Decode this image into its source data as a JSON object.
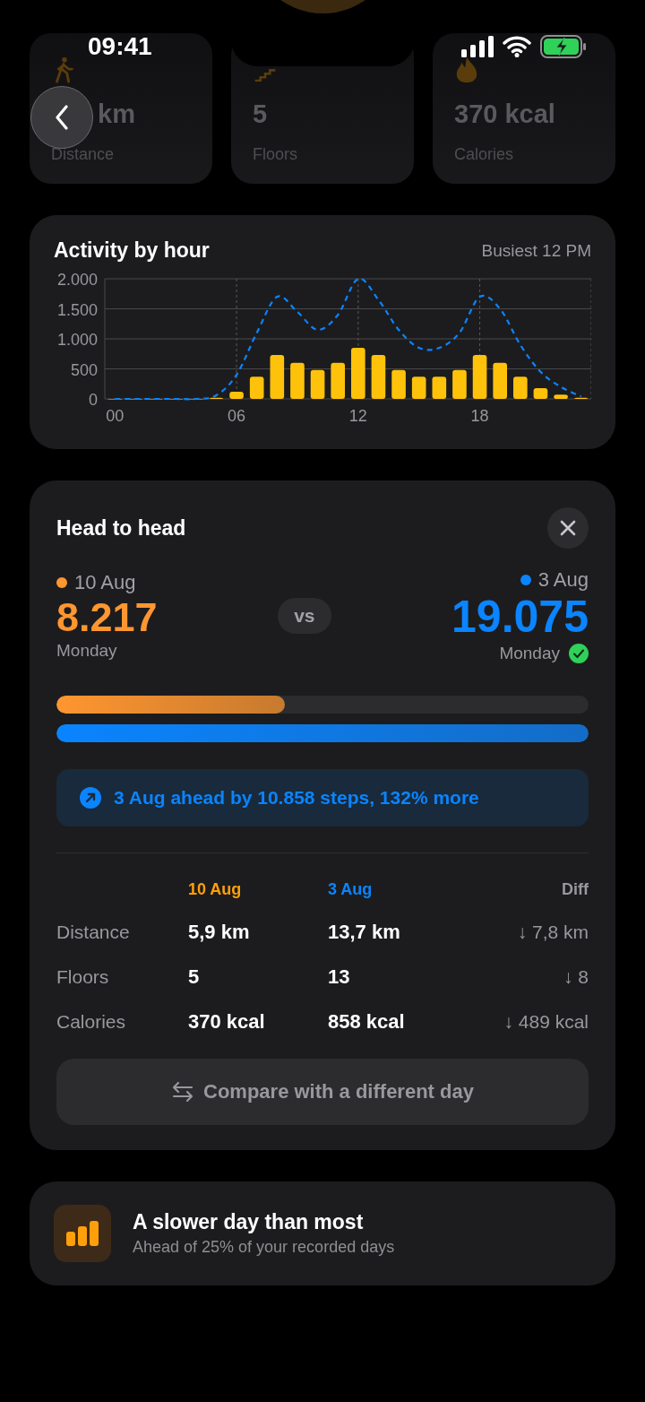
{
  "status_bar": {
    "time": "09:41"
  },
  "stat_cards": [
    {
      "kind": "distance",
      "value": "km",
      "label": "Distance"
    },
    {
      "kind": "floors",
      "value": "5",
      "label": "Floors"
    },
    {
      "kind": "calories",
      "value": "370 kcal",
      "label": "Calories"
    }
  ],
  "activity": {
    "title": "Activity by hour",
    "busiest": "Busiest 12 PM",
    "chart_data": {
      "type": "bar",
      "x": [
        0,
        1,
        2,
        3,
        4,
        5,
        6,
        7,
        8,
        9,
        10,
        11,
        12,
        13,
        14,
        15,
        16,
        17,
        18,
        19,
        20,
        21,
        22,
        23
      ],
      "xlim": [
        -0.5,
        23.5
      ],
      "ylim": [
        0,
        2000
      ],
      "grid": true,
      "xticks": [
        {
          "value": 0,
          "label": "00"
        },
        {
          "value": 6,
          "label": "06"
        },
        {
          "value": 12,
          "label": "12"
        },
        {
          "value": 18,
          "label": "18"
        }
      ],
      "yticks": [
        {
          "value": 0,
          "label": "0"
        },
        {
          "value": 500,
          "label": "500"
        },
        {
          "value": 1000,
          "label": "1.000"
        },
        {
          "value": 1500,
          "label": "1.500"
        },
        {
          "value": 2000,
          "label": "2.000"
        }
      ],
      "series": [
        {
          "color": "#ffc20a",
          "values": [
            0,
            0,
            0,
            0,
            0,
            20,
            120,
            370,
            730,
            600,
            480,
            600,
            850,
            730,
            480,
            370,
            370,
            480,
            730,
            600,
            370,
            180,
            70,
            20
          ]
        },
        {
          "type": "line",
          "line_style": "dashed",
          "color": "#0a84ff",
          "values": [
            0,
            0,
            0,
            0,
            0,
            60,
            400,
            1100,
            1700,
            1450,
            1150,
            1400,
            2000,
            1650,
            1150,
            850,
            850,
            1100,
            1700,
            1500,
            900,
            450,
            200,
            40
          ]
        }
      ]
    }
  },
  "head_to_head": {
    "title": "Head to head",
    "vs": "vs",
    "sides": [
      {
        "date": "10 Aug",
        "steps": "8.217",
        "weekday": "Monday",
        "color": "#ff9630",
        "level": 0.43,
        "winner": false
      },
      {
        "date": "3 Aug",
        "steps": "19.075",
        "weekday": "Monday",
        "color": "#0a84ff",
        "level": 1,
        "winner": true
      }
    ],
    "callout": "3 Aug ahead by 10.858 steps, 132% more",
    "table": {
      "columns": [
        {
          "label": "10 Aug",
          "color": "#ff9f0a"
        },
        {
          "label": "3 Aug",
          "color": "#0a84ff"
        },
        {
          "label": "Diff"
        }
      ],
      "rows": [
        {
          "metric": "Distance",
          "a": "5,9 km",
          "b": "13,7 km",
          "diff": "↓ 7,8 km"
        },
        {
          "metric": "Floors",
          "a": "5",
          "b": "13",
          "diff": "↓ 8"
        },
        {
          "metric": "Calories",
          "a": "370 kcal",
          "b": "858 kcal",
          "diff": "↓ 489 kcal"
        }
      ]
    },
    "compare_button": "Compare with a different day"
  },
  "insight": {
    "title": "A slower day than most",
    "subtitle": "Ahead of 25% of your recorded days"
  }
}
